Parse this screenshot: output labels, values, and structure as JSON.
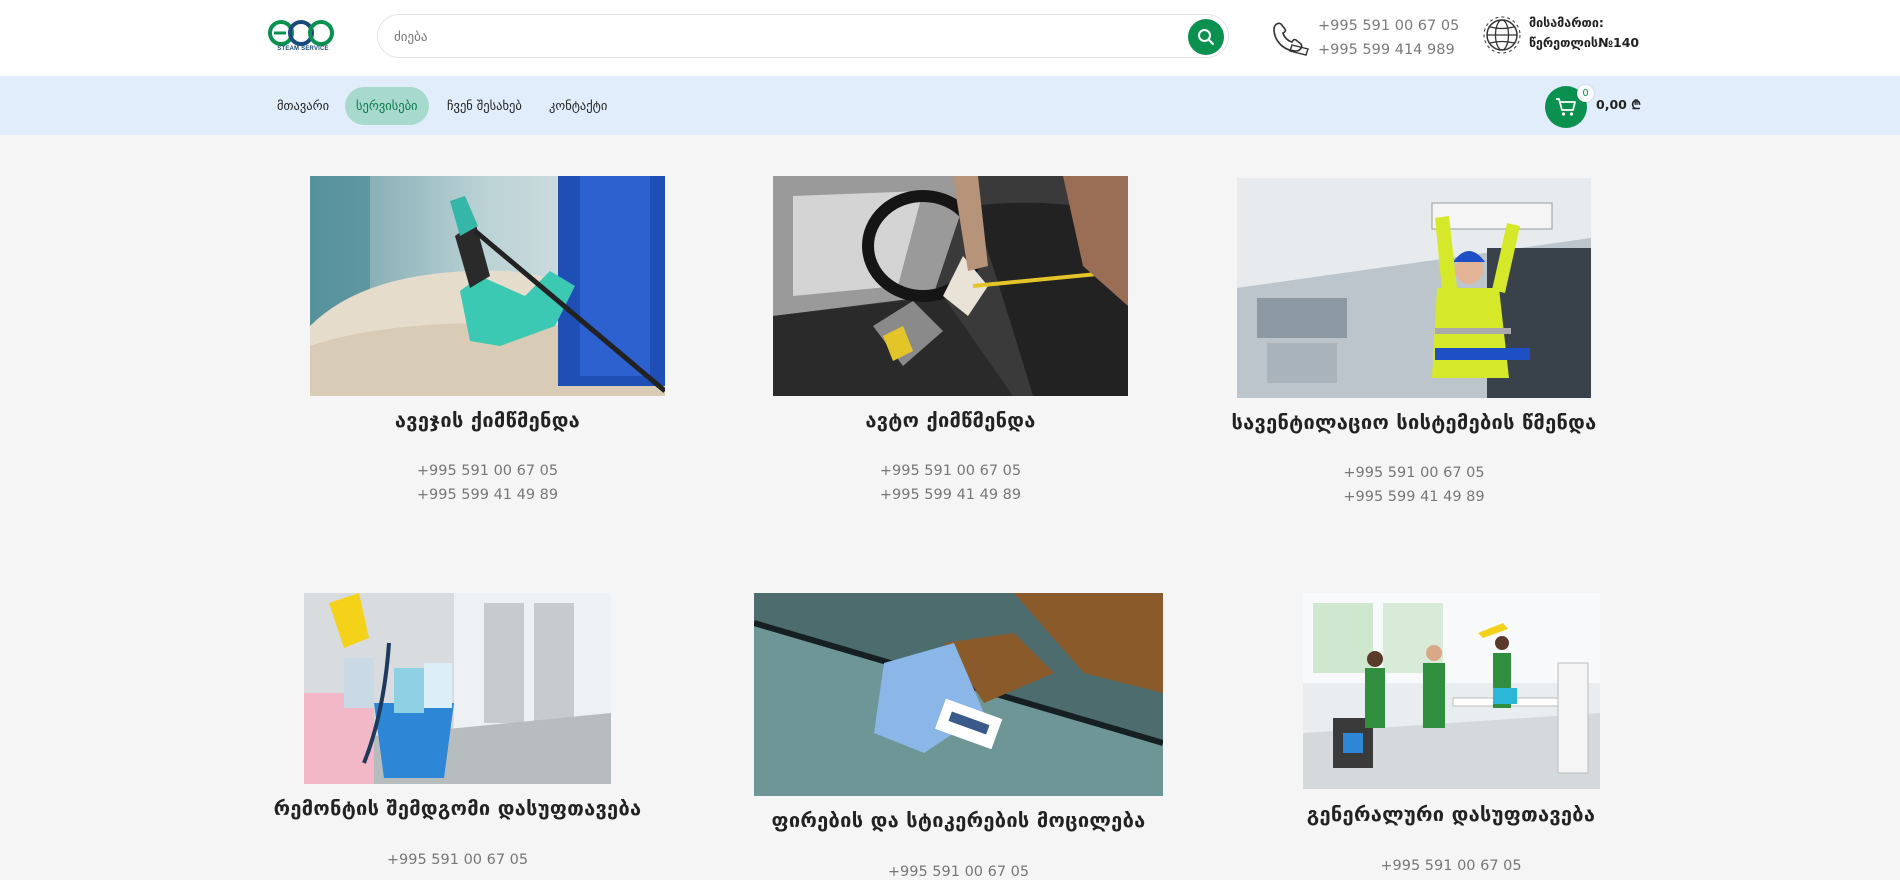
{
  "brand": {
    "logo_text": "ECO",
    "logo_sub": "STEAM SERVICE",
    "colors": {
      "green": "#0a9150",
      "blue": "#1a4a7a",
      "nav_bg": "#e2edfc",
      "active_bg": "#a7d9cd"
    }
  },
  "search": {
    "placeholder": "ძიება",
    "icon": "search-icon"
  },
  "contact": {
    "icon": "phone-icon",
    "phone_1": "+995 591 00 67 05",
    "phone_2": "+995 599 414 989"
  },
  "address": {
    "icon": "globe-icon",
    "label": "მისამართი:",
    "value": "წერეთლის№140"
  },
  "nav": {
    "items": [
      {
        "label": "მთავარი",
        "active": false
      },
      {
        "label": "სერვისები",
        "active": true
      },
      {
        "label": "ჩვენ შესახებ",
        "active": false
      },
      {
        "label": "კონტაქტი",
        "active": false
      }
    ]
  },
  "cart": {
    "icon": "cart-icon",
    "count": "0",
    "total": "0,00 ₾"
  },
  "services": [
    {
      "title": "ავეჯის ქიმწმენდა",
      "phone_1": "+995 591 00 67 05",
      "phone_2": "+995 599 41 49 89"
    },
    {
      "title": "ავტო ქიმწმენდა",
      "phone_1": "+995 591 00 67 05",
      "phone_2": "+995 599 41 49 89"
    },
    {
      "title": "სავენტილაციო სისტემების წმენდა",
      "phone_1": "+995 591 00 67 05",
      "phone_2": "+995 599 41 49 89"
    },
    {
      "title": "რემონტის შემდგომი დასუფთავება",
      "phone_1": "+995 591 00 67 05",
      "phone_2": ""
    },
    {
      "title": "ფირების და სტიკერების მოცილება",
      "phone_1": "+995 591 00 67 05",
      "phone_2": ""
    },
    {
      "title": "გენერალური დასუფთავება",
      "phone_1": "+995 591 00 67 05",
      "phone_2": ""
    }
  ]
}
